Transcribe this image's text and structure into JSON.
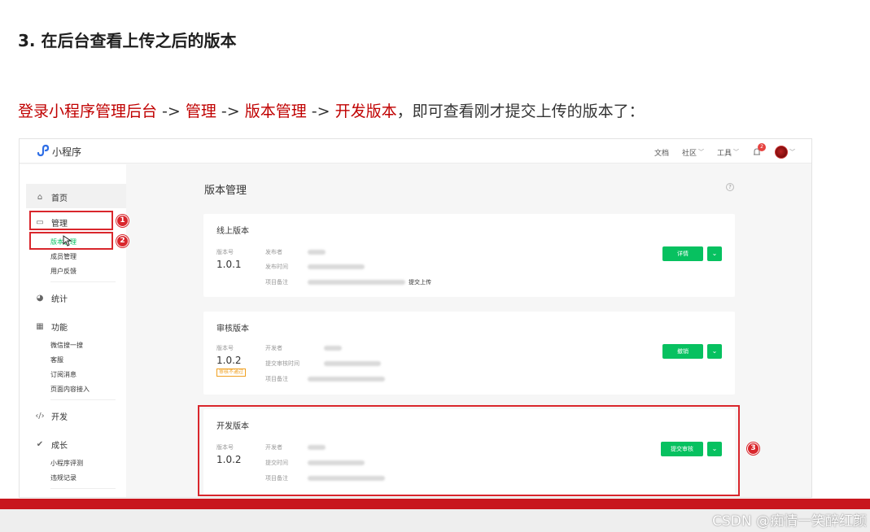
{
  "doc": {
    "heading": "3. 在后台查看上传之后的版本",
    "intro": {
      "p1": "登录小程序管理后台",
      "a1": " -> ",
      "p2": "管理",
      "a2": " -> ",
      "p3": "版本管理",
      "a3": " -> ",
      "p4": "开发版本",
      "tail": "，即可查看刚才提交上传的版本了："
    }
  },
  "app": {
    "name": "小程序",
    "top_nav": {
      "docs": "文档",
      "community": "社区",
      "tools": "工具",
      "notification_count": "2"
    },
    "sidebar": {
      "home": "首页",
      "manage": "管理",
      "manage_subs": [
        "版本管理",
        "成员管理",
        "用户反馈"
      ],
      "stats": "统计",
      "features": "功能",
      "feature_subs": [
        "微信搜一搜",
        "客服",
        "订阅消息",
        "页面内容接入"
      ],
      "dev": "开发",
      "growth": "成长",
      "growth_subs": [
        "小程序评测",
        "违规记录"
      ]
    },
    "main_title": "版本管理",
    "online": {
      "title": "线上版本",
      "version_label": "版本号",
      "version": "1.0.1",
      "field1": "发布者",
      "field2": "发布时间",
      "field3": "项目备注",
      "note": "提交上传",
      "btn": "详情"
    },
    "review": {
      "title": "审核版本",
      "version_label": "版本号",
      "version": "1.0.2",
      "status": "审核不通过",
      "field1": "开发者",
      "field2": "提交审核时间",
      "field3": "项目备注",
      "btn": "撤销"
    },
    "develop": {
      "title": "开发版本",
      "version_label": "版本号",
      "version": "1.0.2",
      "field1": "开发者",
      "field2": "提交时间",
      "field3": "项目备注",
      "btn": "提交审核"
    },
    "markers": [
      "1",
      "2",
      "3"
    ]
  },
  "watermark": "CSDN @痴情一笑醉红颜",
  "colors": {
    "accent_green": "#07c160",
    "highlight_red": "#d9262c",
    "text_red": "#c00000"
  }
}
